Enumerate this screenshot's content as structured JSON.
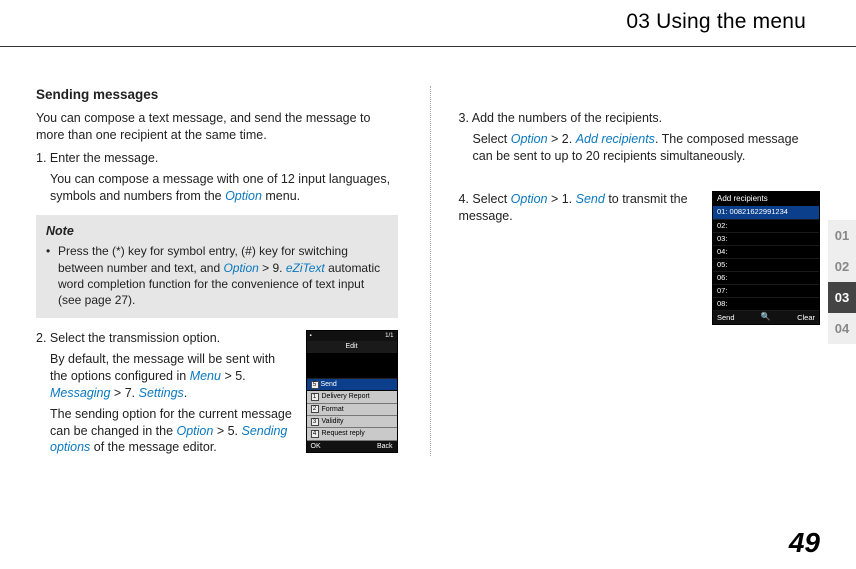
{
  "header": {
    "chapter": "03 Using the menu"
  },
  "side_tabs": [
    "01",
    "02",
    "03",
    "04"
  ],
  "active_tab_index": 2,
  "page_number": "49",
  "left": {
    "title": "Sending messages",
    "intro": "You can compose a text message, and send the message to more than one recipient at the same time.",
    "step1": {
      "num": "1.",
      "text": "Enter the message.",
      "detail_before": "You can compose a message with one of 12 input languages, symbols and numbers from the ",
      "ref1": "Option",
      "detail_after": " menu."
    },
    "note": {
      "label": "Note",
      "body_a": "Press the (*) key for symbol entry, (#) key for switching between number and text, and ",
      "ref1": "Option",
      "sep1": " > 9. ",
      "ref2": "eZiText",
      "body_b": " automatic word completion function for the convenience of text input (see page 27)."
    },
    "step2": {
      "num": "2.",
      "text": "Select the transmission option.",
      "p1_a": "By default, the message will be sent with the options configured in ",
      "ref1": "Menu",
      "sep1": " > 5. ",
      "ref2": "Messaging",
      "sep2": " > 7. ",
      "ref3": "Settings",
      "p1_b": ".",
      "p2_a": "The sending option for the current message can be changed in the ",
      "ref4": "Option",
      "sep3": " > 5. ",
      "ref5": "Sending options",
      "p2_b": " of the message editor."
    },
    "shot1": {
      "topbar_left": "▪",
      "topbar_right": "1/1",
      "title": "Edit",
      "hl_num": "5",
      "hl_label": "Send",
      "items": [
        {
          "n": "1",
          "l": "Delivery Report"
        },
        {
          "n": "2",
          "l": "Format"
        },
        {
          "n": "3",
          "l": "Validity"
        },
        {
          "n": "4",
          "l": "Request reply"
        }
      ],
      "soft_left": "OK",
      "soft_right": "Back"
    }
  },
  "right": {
    "step3": {
      "num": "3.",
      "text": "Add the numbers of the recipients.",
      "p_a": "Select ",
      "ref1": "Option",
      "sep1": " > 2. ",
      "ref2": "Add recipients",
      "p_b": ". The composed message can be sent to up to 20 recipients simultaneously."
    },
    "step4": {
      "num": "4.",
      "text_a": "Select ",
      "ref1": "Option",
      "sep1": " > 1. ",
      "ref2": "Send",
      "text_b": " to transmit the message."
    },
    "shot2": {
      "title": "Add recipients",
      "rows": [
        {
          "n": "01:",
          "v": "00821622991234",
          "hl": true
        },
        {
          "n": "02:",
          "v": ""
        },
        {
          "n": "03:",
          "v": ""
        },
        {
          "n": "04:",
          "v": ""
        },
        {
          "n": "05:",
          "v": ""
        },
        {
          "n": "06:",
          "v": ""
        },
        {
          "n": "07:",
          "v": ""
        },
        {
          "n": "08:",
          "v": ""
        }
      ],
      "soft_left": "Send",
      "soft_right": "Clear"
    }
  }
}
